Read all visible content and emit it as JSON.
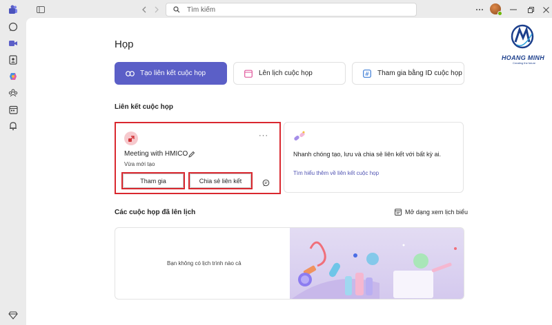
{
  "search": {
    "placeholder": "Tìm kiếm"
  },
  "page": {
    "title": "Họp"
  },
  "actions": [
    {
      "label": "Tạo liên kết cuộc họp"
    },
    {
      "label": "Lên lịch cuộc họp"
    },
    {
      "label": "Tham gia bằng ID cuộc họp"
    }
  ],
  "links_section": {
    "title": "Liên kết cuộc họp"
  },
  "meeting_card": {
    "title": "Meeting with HMICO",
    "subtitle": "Vừa mới tạo",
    "more": "···",
    "join_label": "Tham gia",
    "share_label": "Chia sẻ liên kết"
  },
  "info_card": {
    "text": "Nhanh chóng tạo, lưu và chia sẻ liên kết với bất kỳ ai.",
    "link": "Tìm hiểu thêm về liên kết cuộc họp"
  },
  "scheduled": {
    "title": "Các cuộc họp đã lên lịch",
    "calendar_view_label": "Mở dạng xem lịch biểu",
    "empty_text": "Bạn không có lịch trình nào cả"
  },
  "watermark": {
    "brand": "HOANG MINH",
    "tagline": "Creating the future"
  },
  "colors": {
    "accent": "#5b5fc7",
    "highlight": "#d9272e",
    "link": "#4f52b2"
  }
}
